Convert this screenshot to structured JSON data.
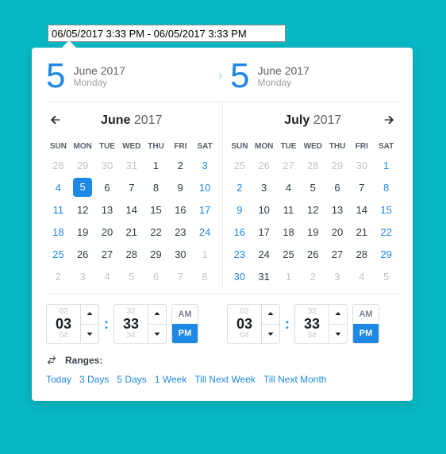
{
  "input_value": "06/05/2017 3:33 PM - 06/05/2017 3:33 PM",
  "start": {
    "day": "5",
    "month_year": "June 2017",
    "weekday": "Monday"
  },
  "end": {
    "day": "5",
    "month_year": "June 2017",
    "weekday": "Monday"
  },
  "dow": [
    "SUN",
    "MON",
    "TUE",
    "WED",
    "THU",
    "FRI",
    "SAT"
  ],
  "cal_left": {
    "month": "June",
    "year": "2017",
    "cells": [
      {
        "n": "28",
        "t": "out"
      },
      {
        "n": "29",
        "t": "out"
      },
      {
        "n": "30",
        "t": "out"
      },
      {
        "n": "31",
        "t": "out"
      },
      {
        "n": "1",
        "t": "in"
      },
      {
        "n": "2",
        "t": "in"
      },
      {
        "n": "3",
        "t": "wkend"
      },
      {
        "n": "4",
        "t": "wkend"
      },
      {
        "n": "5",
        "t": "sel"
      },
      {
        "n": "6",
        "t": "in"
      },
      {
        "n": "7",
        "t": "in"
      },
      {
        "n": "8",
        "t": "in"
      },
      {
        "n": "9",
        "t": "in"
      },
      {
        "n": "10",
        "t": "wkend"
      },
      {
        "n": "11",
        "t": "wkend"
      },
      {
        "n": "12",
        "t": "in"
      },
      {
        "n": "13",
        "t": "in"
      },
      {
        "n": "14",
        "t": "in"
      },
      {
        "n": "15",
        "t": "in"
      },
      {
        "n": "16",
        "t": "in"
      },
      {
        "n": "17",
        "t": "wkend"
      },
      {
        "n": "18",
        "t": "wkend"
      },
      {
        "n": "19",
        "t": "in"
      },
      {
        "n": "20",
        "t": "in"
      },
      {
        "n": "21",
        "t": "in"
      },
      {
        "n": "22",
        "t": "in"
      },
      {
        "n": "23",
        "t": "in"
      },
      {
        "n": "24",
        "t": "wkend"
      },
      {
        "n": "25",
        "t": "wkend"
      },
      {
        "n": "26",
        "t": "in"
      },
      {
        "n": "27",
        "t": "in"
      },
      {
        "n": "28",
        "t": "in"
      },
      {
        "n": "29",
        "t": "in"
      },
      {
        "n": "30",
        "t": "in"
      },
      {
        "n": "1",
        "t": "out"
      },
      {
        "n": "2",
        "t": "out"
      },
      {
        "n": "3",
        "t": "out"
      },
      {
        "n": "4",
        "t": "out"
      },
      {
        "n": "5",
        "t": "out"
      },
      {
        "n": "6",
        "t": "out"
      },
      {
        "n": "7",
        "t": "out"
      },
      {
        "n": "8",
        "t": "out"
      }
    ]
  },
  "cal_right": {
    "month": "July",
    "year": "2017",
    "cells": [
      {
        "n": "25",
        "t": "out"
      },
      {
        "n": "26",
        "t": "out"
      },
      {
        "n": "27",
        "t": "out"
      },
      {
        "n": "28",
        "t": "out"
      },
      {
        "n": "29",
        "t": "out"
      },
      {
        "n": "30",
        "t": "out"
      },
      {
        "n": "1",
        "t": "wkend"
      },
      {
        "n": "2",
        "t": "wkend"
      },
      {
        "n": "3",
        "t": "in"
      },
      {
        "n": "4",
        "t": "in"
      },
      {
        "n": "5",
        "t": "in"
      },
      {
        "n": "6",
        "t": "in"
      },
      {
        "n": "7",
        "t": "in"
      },
      {
        "n": "8",
        "t": "wkend"
      },
      {
        "n": "9",
        "t": "wkend"
      },
      {
        "n": "10",
        "t": "in"
      },
      {
        "n": "11",
        "t": "in"
      },
      {
        "n": "12",
        "t": "in"
      },
      {
        "n": "13",
        "t": "in"
      },
      {
        "n": "14",
        "t": "in"
      },
      {
        "n": "15",
        "t": "wkend"
      },
      {
        "n": "16",
        "t": "wkend"
      },
      {
        "n": "17",
        "t": "in"
      },
      {
        "n": "18",
        "t": "in"
      },
      {
        "n": "19",
        "t": "in"
      },
      {
        "n": "20",
        "t": "in"
      },
      {
        "n": "21",
        "t": "in"
      },
      {
        "n": "22",
        "t": "wkend"
      },
      {
        "n": "23",
        "t": "wkend"
      },
      {
        "n": "24",
        "t": "in"
      },
      {
        "n": "25",
        "t": "in"
      },
      {
        "n": "26",
        "t": "in"
      },
      {
        "n": "27",
        "t": "in"
      },
      {
        "n": "28",
        "t": "in"
      },
      {
        "n": "29",
        "t": "wkend"
      },
      {
        "n": "30",
        "t": "wkend"
      },
      {
        "n": "31",
        "t": "in"
      },
      {
        "n": "1",
        "t": "out"
      },
      {
        "n": "2",
        "t": "out"
      },
      {
        "n": "3",
        "t": "out"
      },
      {
        "n": "4",
        "t": "out"
      },
      {
        "n": "5",
        "t": "out"
      }
    ]
  },
  "time_start": {
    "hour_prev": "02",
    "hour": "03",
    "hour_next": "04",
    "min_prev": "32",
    "min": "33",
    "min_next": "34",
    "am": "AM",
    "pm": "PM",
    "period": "PM"
  },
  "time_end": {
    "hour_prev": "02",
    "hour": "03",
    "hour_next": "04",
    "min_prev": "32",
    "min": "33",
    "min_next": "34",
    "am": "AM",
    "pm": "PM",
    "period": "PM"
  },
  "ranges": {
    "label": "Ranges:",
    "items": [
      "Today",
      "3 Days",
      "5 Days",
      "1 Week",
      "Till Next Week",
      "Till Next Month"
    ]
  }
}
